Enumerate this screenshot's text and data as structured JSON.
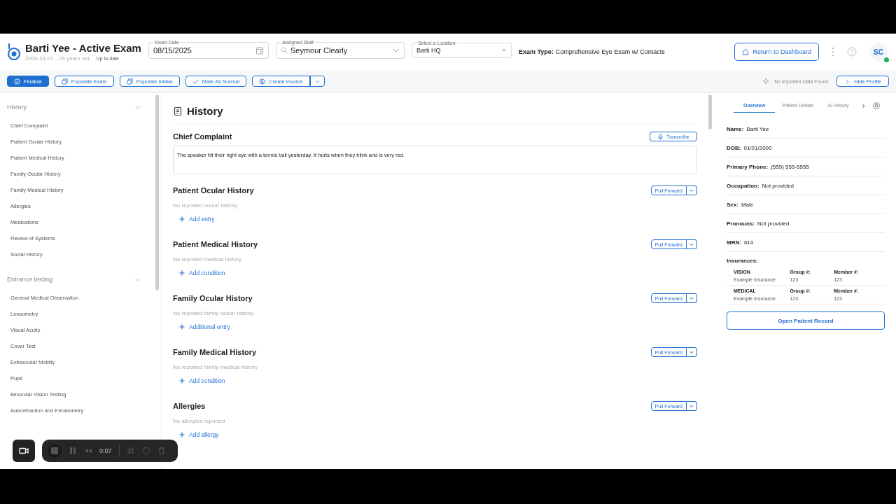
{
  "header": {
    "title": "Barti Yee - Active Exam",
    "subtitle": "2000-01-01 - 25 years old",
    "sync_status": "Up to date",
    "exam_date": {
      "label": "Exam Date",
      "value": "08/15/2025"
    },
    "assigned_staff": {
      "label": "Assigned Staff",
      "value": "Seymour Clearly"
    },
    "location": {
      "label": "Select a Location",
      "value": "Barti HQ"
    },
    "exam_type": {
      "label": "Exam Type:",
      "value": "Comprehensive Eye Exam w/ Contacts"
    },
    "return_button": "Return to Dashboard",
    "avatar": {
      "initials": "SC",
      "online": true
    }
  },
  "toolbar": {
    "buttons": [
      {
        "label": "Finalize",
        "kind": "primary"
      },
      {
        "label": "Populate Exam",
        "kind": "outline"
      },
      {
        "label": "Populate Intake",
        "kind": "outline"
      },
      {
        "label": "Mark As Normal",
        "kind": "outline"
      },
      {
        "label": "Create Invoice",
        "kind": "split"
      }
    ],
    "import_status": "No Imported Data Found",
    "hide_profile": "Hide Profile"
  },
  "sidebar": {
    "groups": [
      {
        "title": "History",
        "expanded": true,
        "items": [
          "Chief Complaint",
          "Patient Ocular History",
          "Patient Medical History",
          "Family Ocular History",
          "Family Medical History",
          "Allergies",
          "Medications",
          "Review of Systems",
          "Social History"
        ]
      },
      {
        "title": "Entrance testing",
        "expanded": true,
        "items": [
          "General Medical Observation",
          "Lensometry",
          "Visual Acuity",
          "Cover Test",
          "Extraocular Motility",
          "Pupil",
          "Binocular Vision Testing",
          "Autorefraction and Keratometry"
        ]
      }
    ]
  },
  "main": {
    "title": "History",
    "sections": [
      {
        "kind": "note",
        "title": "Chief Complaint",
        "action": "Transcribe",
        "value": "The speaker hit their right eye with a tennis ball yesterday. It hurts when they blink and is very red."
      },
      {
        "kind": "list",
        "title": "Patient Ocular History",
        "action": "Pull Forward",
        "empty": "No reported ocular history",
        "add": "Add entry"
      },
      {
        "kind": "list",
        "title": "Patient Medical History",
        "action": "Pull Forward",
        "empty": "No reported medical history",
        "add": "Add condition"
      },
      {
        "kind": "list",
        "title": "Family Ocular History",
        "action": "Pull Forward",
        "empty": "No reported family ocular history",
        "add": "Additional entry"
      },
      {
        "kind": "list",
        "title": "Family Medical History",
        "action": "Pull Forward",
        "empty": "No reported family medical history",
        "add": "Add condition"
      },
      {
        "kind": "list",
        "title": "Allergies",
        "action": "Pull Forward",
        "empty": "No allergies reported",
        "add": "Add allergy"
      }
    ]
  },
  "profile": {
    "tabs": [
      {
        "label": "Overview",
        "selected": true
      },
      {
        "label": "Patient Details",
        "selected": false
      },
      {
        "label": "AI History",
        "selected": false
      }
    ],
    "fields": [
      {
        "label": "Name:",
        "value": "Barti Yee"
      },
      {
        "label": "DOB:",
        "value": "01/01/2000"
      },
      {
        "label": "Primary Phone:",
        "value": "(555) 555-5555"
      },
      {
        "label": "Occupation:",
        "value": "Not provided"
      },
      {
        "label": "Sex:",
        "value": "Male"
      },
      {
        "label": "Pronouns:",
        "value": "Not provided"
      },
      {
        "label": "MRN:",
        "value": "614"
      }
    ],
    "insurances_label": "Insurances:",
    "insurances": [
      {
        "type": "VISION",
        "carrier": "Example Insurance",
        "group_label": "Group #:",
        "group": "123",
        "member_label": "Member #:",
        "member": "123"
      },
      {
        "type": "MEDICAL",
        "carrier": "Example Insurance",
        "group_label": "Group #:",
        "group": "123",
        "member_label": "Member #:",
        "member": "123"
      }
    ],
    "open_button": "Open Patient Record"
  },
  "recorder": {
    "time": "0:07"
  }
}
